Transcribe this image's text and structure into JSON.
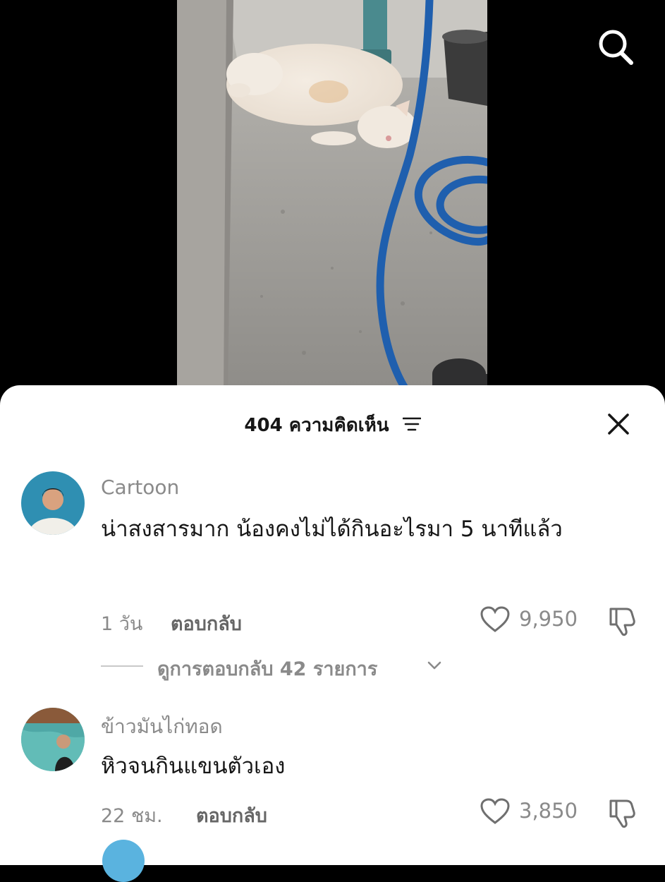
{
  "video": {
    "search_icon": "search-icon",
    "subject": "white cat lying on concrete floor next to a blue garden hose"
  },
  "comments_sheet": {
    "count_label": "404 ความคิดเห็น",
    "sort_icon": "sort-lines-icon",
    "close_icon": "close-icon"
  },
  "comments": [
    {
      "username": "Cartoon",
      "text": "น่าสงสารมาก น้องคงไม่ได้กินอะไรมา 5 นาทีแล้ว",
      "time": "1 วัน",
      "reply_label": "ตอบกลับ",
      "likes": "9,950",
      "view_replies_label": "ดูการตอบกลับ 42 รายการ"
    },
    {
      "username": "ข้าวมันไก่ทอด",
      "text": "หิวจนกินแขนตัวเอง",
      "time": "22 ชม.",
      "reply_label": "ตอบกลับ",
      "likes": "3,850"
    }
  ],
  "colors": {
    "hose": "#1f5fae",
    "sheet_bg": "#ffffff",
    "secondary_text": "#8a8a8a"
  }
}
